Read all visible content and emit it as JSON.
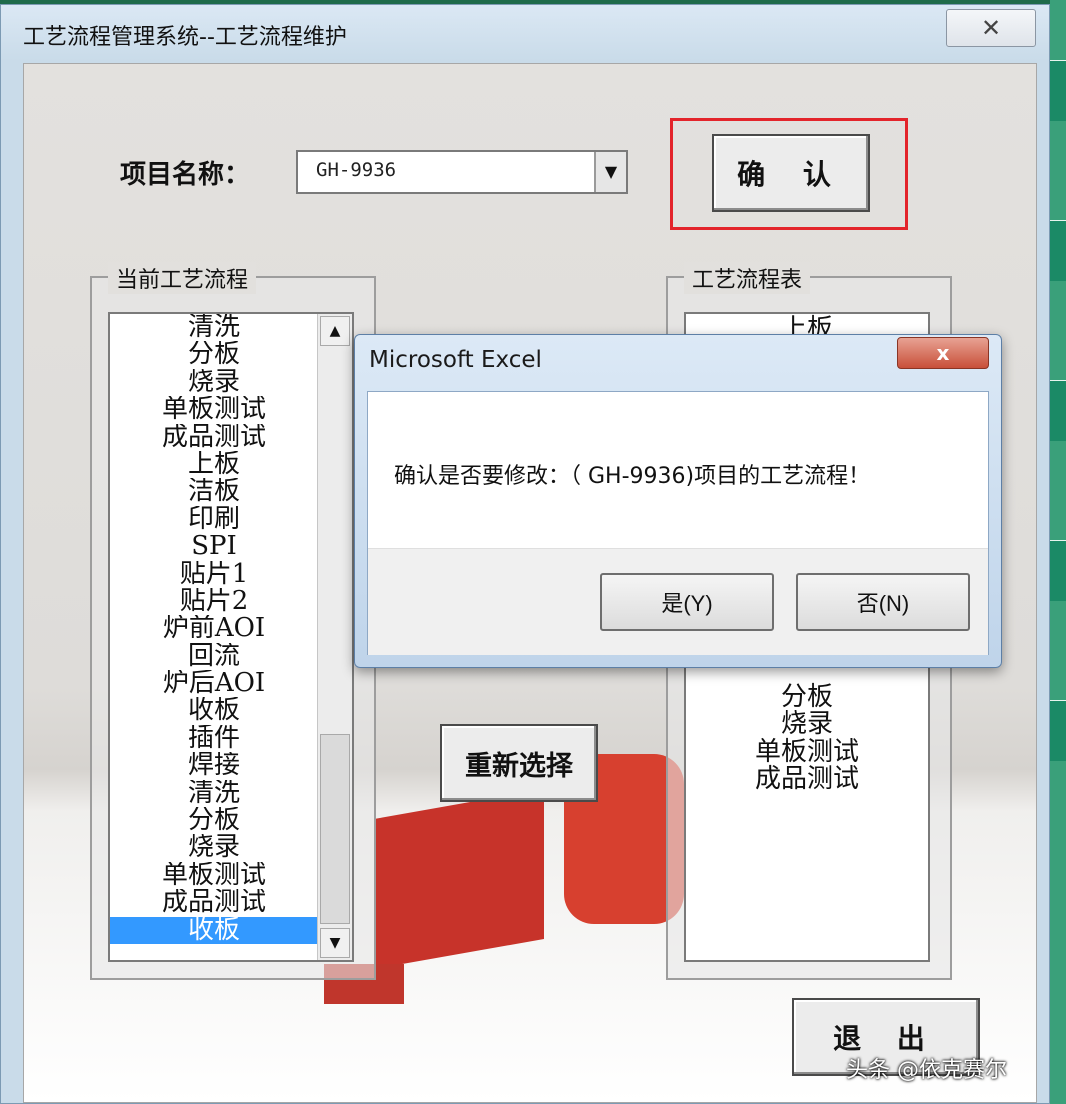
{
  "window": {
    "title": "工艺流程管理系统--工艺流程维护",
    "close_glyph": "✕"
  },
  "form": {
    "project_label": "项目名称：",
    "project_value": "GH-9936",
    "confirm_label": "确 认",
    "reselect_label": "重新选择",
    "exit_label": "退 出"
  },
  "current_process": {
    "title": "当前工艺流程",
    "items": [
      "清洗",
      "分板",
      "烧录",
      "单板测试",
      "成品测试",
      "上板",
      "洁板",
      "印刷",
      "SPI",
      "贴片1",
      "贴片2",
      "炉前AOI",
      "回流",
      "炉后AOI",
      "收板",
      "插件",
      "焊接",
      "清洗",
      "分板",
      "烧录",
      "单板测试",
      "成品测试",
      "收板"
    ],
    "selected_index": 22
  },
  "process_table": {
    "title": "工艺流程表",
    "items_top": [
      "上板"
    ],
    "items_bottom": [
      "分板",
      "烧录",
      "单板测试",
      "成品测试"
    ]
  },
  "dialog": {
    "title": "Microsoft Excel",
    "message": "确认是否要修改：（ GH-9936)项目的工艺流程！",
    "yes_label": "是(Y)",
    "no_label": "否(N)",
    "close_glyph": "x"
  },
  "watermark": "头条 @依克赛尔"
}
